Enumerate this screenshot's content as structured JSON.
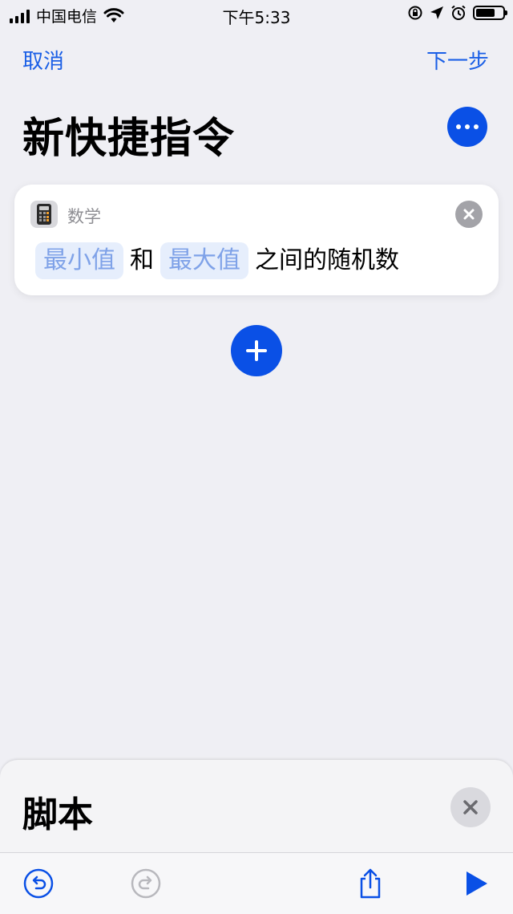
{
  "status_bar": {
    "carrier": "中国电信",
    "time": "下午5:33",
    "icons": [
      "signal-icon",
      "wifi-icon",
      "orientation-lock-icon",
      "location-arrow-icon",
      "alarm-icon",
      "battery-icon"
    ]
  },
  "nav": {
    "cancel_label": "取消",
    "next_label": "下一步"
  },
  "header": {
    "title": "新快捷指令",
    "more_icon": "ellipsis-icon"
  },
  "action_card": {
    "category": "数学",
    "icon": "calculator-icon",
    "min_token": "最小值",
    "connector": "和",
    "max_token": "最大值",
    "suffix": "之间的随机数"
  },
  "bottom_sheet": {
    "title": "脚本"
  },
  "toolbar": {
    "icons": [
      "undo-icon",
      "redo-icon",
      "share-icon",
      "play-icon"
    ]
  },
  "colors": {
    "accent": "#0a50e6",
    "link": "#1a5fe6",
    "background": "#efeff4",
    "token_bg": "#e6eefc",
    "token_text": "#7fa2e8"
  }
}
